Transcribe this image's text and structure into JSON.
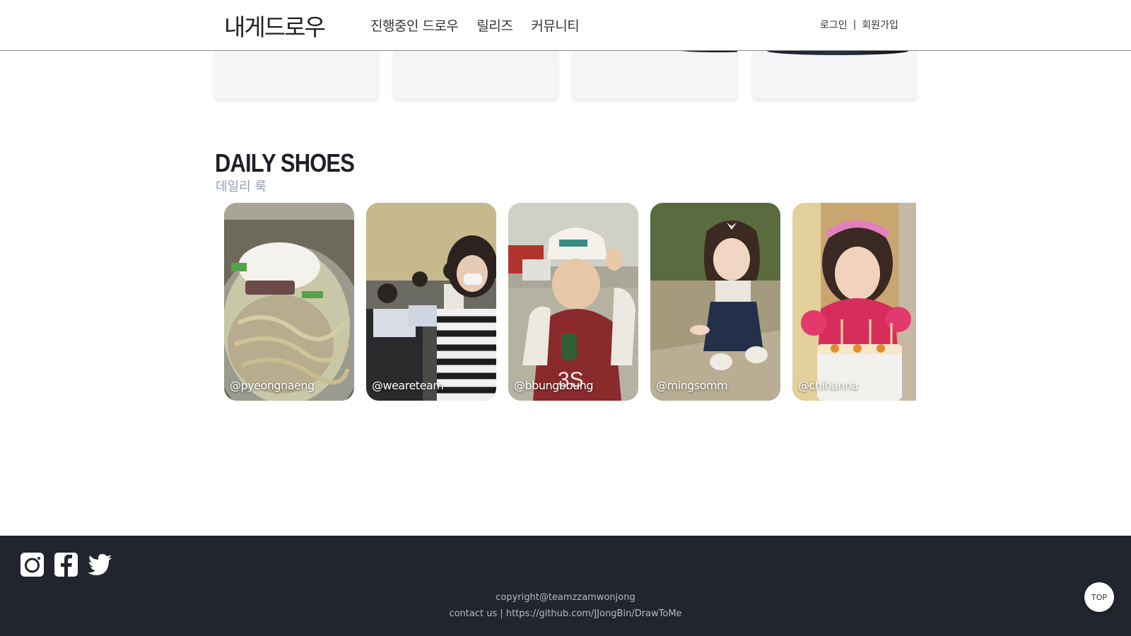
{
  "header": {
    "logo": "내게드로우",
    "nav": [
      {
        "label": "진행중인 드로우"
      },
      {
        "label": "릴리즈"
      },
      {
        "label": "커뮤니티"
      }
    ],
    "login": "로그인",
    "separator": "|",
    "signup": "회원가입"
  },
  "section": {
    "title": "DAILY SHOES",
    "subtitle": "데일리 룩"
  },
  "daily_cards": [
    {
      "handle": "@pyeongnaeng",
      "image": "noodle-photo"
    },
    {
      "handle": "@weareteam",
      "image": "team-photo"
    },
    {
      "handle": "@bbungbbung",
      "image": "child-cap-photo"
    },
    {
      "handle": "@mingsomm",
      "image": "toddler-photo"
    },
    {
      "handle": "@chihanna",
      "image": "birthday-photo"
    }
  ],
  "footer": {
    "copyright": "copyright@teamzzamwonjong",
    "contact_prefix": "contact us | ",
    "contact_link": "https://github.com/JJongBin/DrawToMe",
    "top_label": "TOP"
  },
  "colors": {
    "footer_bg": "#22242e",
    "subtitle": "#8f9fb8",
    "card_bg": "#f5f4f6"
  }
}
